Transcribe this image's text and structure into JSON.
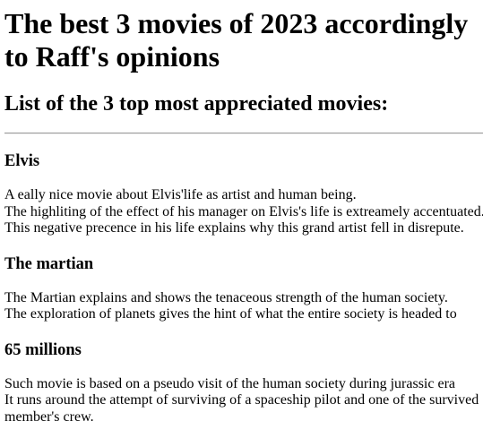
{
  "header": {
    "title": "The best 3 movies of 2023 accordingly to Raff's opinions",
    "subtitle": "List of the 3 top most appreciated movies:"
  },
  "movies": [
    {
      "title": "Elvis",
      "lines": [
        "A eally nice movie about Elvis'life as artist and human being.",
        "The highliting of the effect of his manager on Elvis's life is extreamely accentuated.",
        "This negative precence in his life explains why this grand artist fell in disrepute."
      ]
    },
    {
      "title": "The martian",
      "lines": [
        "The Martian explains and shows the tenaceous strength of the human society.",
        "The exploration of planets gives the hint of what the entire society is headed to"
      ]
    },
    {
      "title": "65 millions",
      "lines": [
        "Such movie is based on a pseudo visit of the human society during jurassic era",
        "It runs around the attempt of surviving of a spaceship pilot and one of the survived member's crew."
      ]
    }
  ]
}
